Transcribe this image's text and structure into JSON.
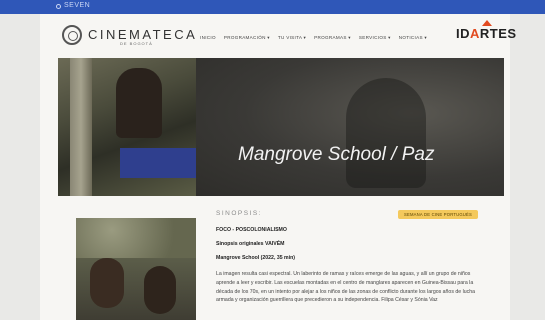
{
  "top_strip": {
    "text": "SEVEN"
  },
  "header": {
    "logo_name": "CINEMATECA",
    "logo_sub": "DE BOGOTÁ",
    "nav": [
      "INICIO",
      "PROGRAMACIÓN ▾",
      "TU VISITA ▾",
      "PROGRAMAS ▾",
      "SERVICIOS ▾",
      "NOTICIAS ▾"
    ],
    "partner_logo": {
      "prefix": "ID",
      "accent": "A",
      "suffix": "RTES",
      "accent_color": "#e24a1f"
    }
  },
  "hero": {
    "title": "Mangrove School / Paz"
  },
  "content": {
    "section_label": "SINOPSIS:",
    "badge": "SEMANA DE CINE PORTUGUÉS",
    "lines": [
      "FOCO - POSCOLONIALISMO",
      "Sinopsis originales VAIVÉM",
      "Mangrove School (2022, 35 min)"
    ],
    "paragraph": "La imagen resulta casi espectral. Un laberinto de ramas y raíces emerge de las aguas, y allí un grupo de niños aprende a leer y escribir. Las escuelas montadas en el centro de manglares aparecen en Guinea-Bissau para la década de los 70s, en un intento por alejar a los niños de las zonas de conflicto durante los largos años de lucha armada y organización guerrillera que precedieron a su independencia. Filipa César y Sónia Vaz"
  },
  "colors": {
    "top_strip": "#2f57b8",
    "badge": "#f4c95c",
    "background": "#e9e9e7"
  }
}
